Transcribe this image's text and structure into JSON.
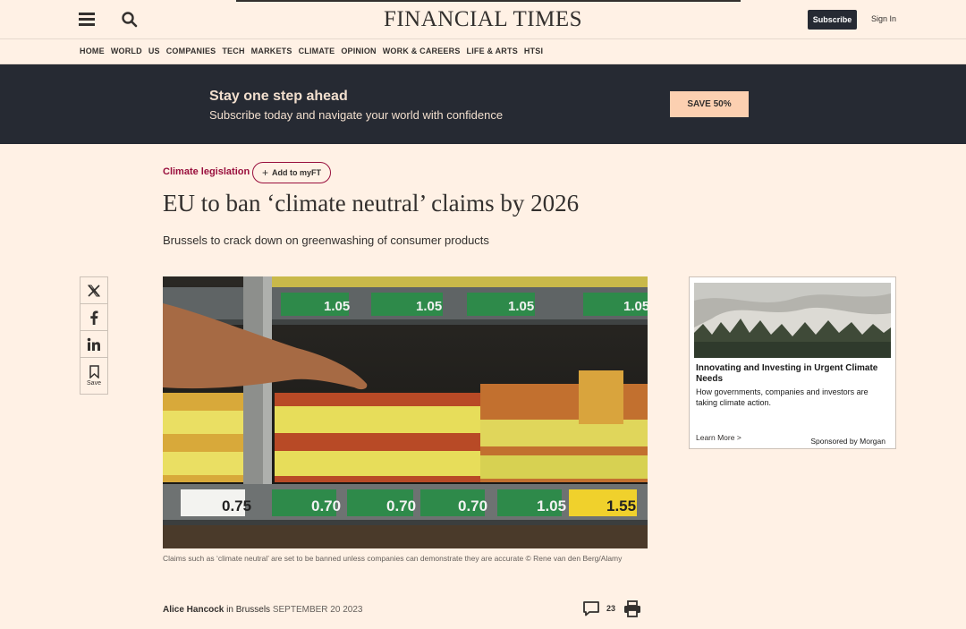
{
  "header": {
    "logo": "FINANCIAL TIMES",
    "subscribe_label": "Subscribe",
    "signin_label": "Sign In"
  },
  "nav": {
    "items": [
      "HOME",
      "WORLD",
      "US",
      "COMPANIES",
      "TECH",
      "MARKETS",
      "CLIMATE",
      "OPINION",
      "WORK & CAREERS",
      "LIFE & ARTS",
      "HTSI"
    ]
  },
  "promo": {
    "title": "Stay one step ahead",
    "subtitle": "Subscribe today and navigate your world with confidence",
    "button_label": "SAVE 50%"
  },
  "article": {
    "topic": "Climate legislation",
    "myft_label": "Add to myFT",
    "headline": "EU to ban ‘climate neutral’ claims by 2026",
    "standfirst": "Brussels to crack down on greenwashing of consumer products",
    "caption": "Claims such as ‘climate neutral’ are set to be banned unless companies can demonstrate they are accurate © Rene van den Berg/Alamy",
    "author": "Alice Hancock",
    "location_prefix": " in Brussels ",
    "date": "SEPTEMBER 20 2023",
    "comment_count": "23"
  },
  "share": {
    "save_label": "Save",
    "icons": [
      "x-icon",
      "facebook-icon",
      "linkedin-icon",
      "bookmark-icon"
    ]
  },
  "ad": {
    "title": "Innovating and Investing in Urgent Climate Needs",
    "description": "How governments, companies and investors are taking climate action.",
    "learn_more": "Learn More >",
    "sponsor": "Sponsored by Morgan"
  },
  "colors": {
    "background": "#fff1e5",
    "promo_bg": "#262a33",
    "promo_button": "#fcd0b1",
    "topic": "#990f3d",
    "text": "#33302e"
  }
}
